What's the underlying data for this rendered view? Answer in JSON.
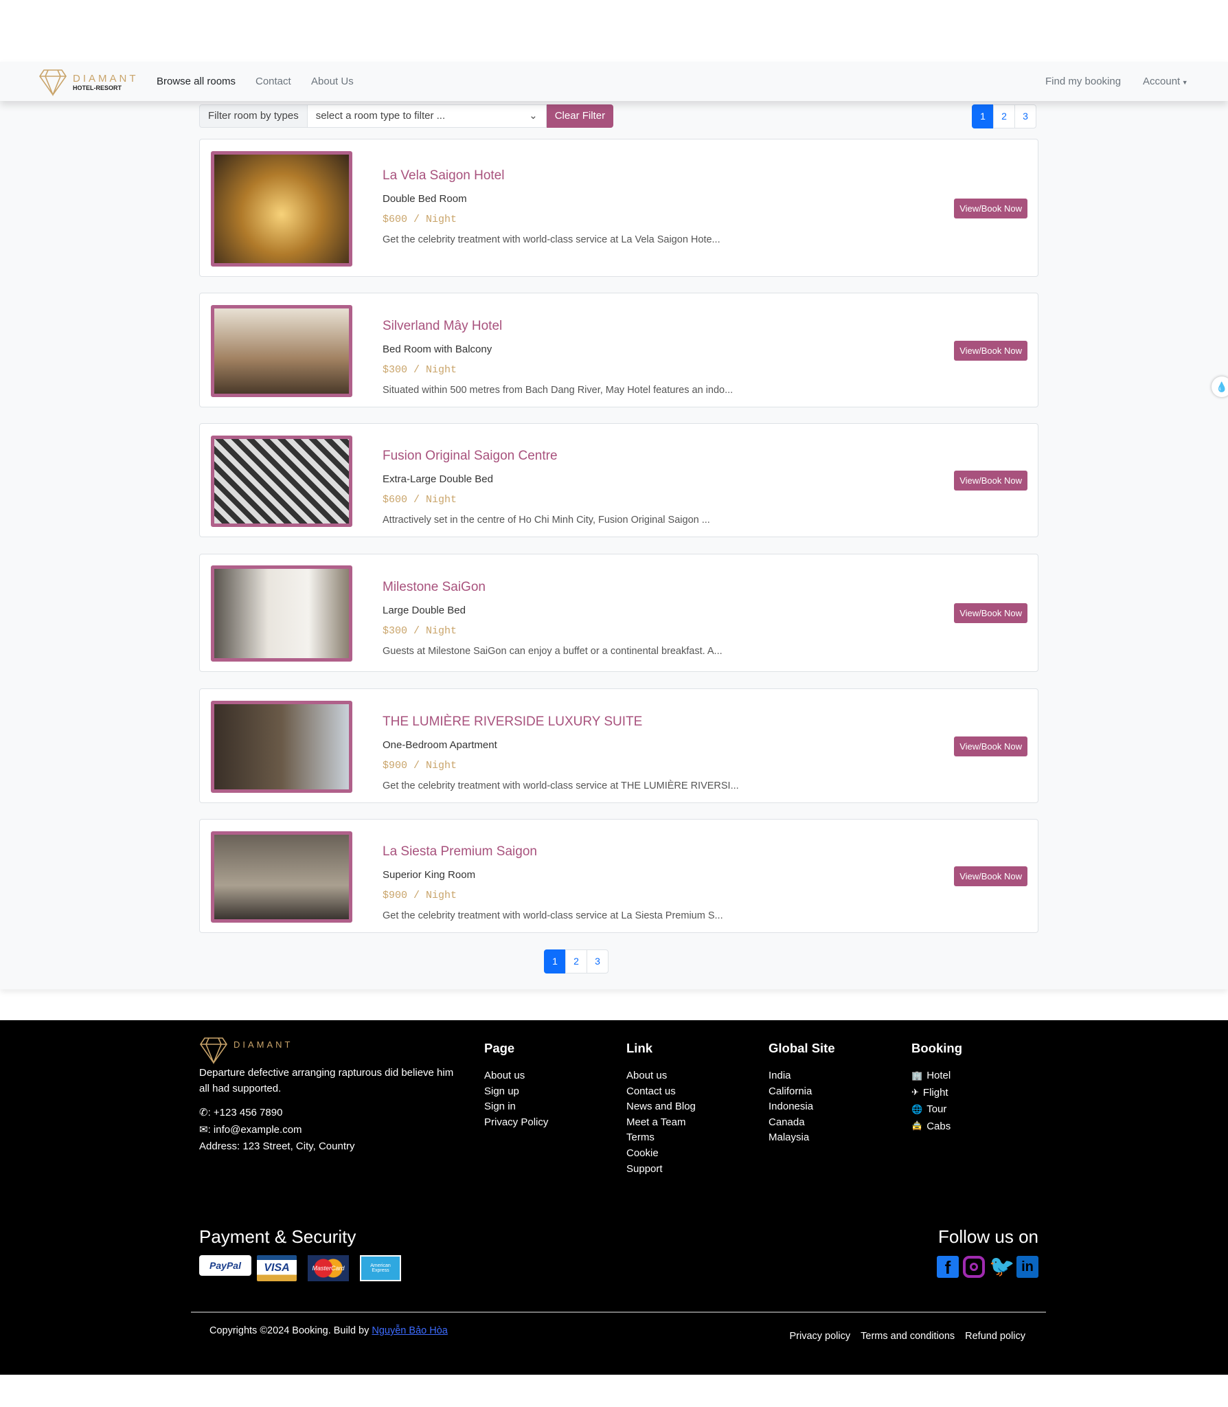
{
  "brand": {
    "name": "DIAMANT",
    "tagline": "HOTEL-RESORT",
    "gold": "#c9a46a",
    "accent": "#a8527d"
  },
  "nav": {
    "links": [
      "Browse all rooms",
      "Contact",
      "About Us"
    ],
    "right": [
      "Find my booking",
      "Account"
    ]
  },
  "filter": {
    "label": "Filter room by types",
    "placeholder": "select a room type to filter ...",
    "clear": "Clear Filter"
  },
  "pagination": {
    "pages": [
      "1",
      "2",
      "3"
    ],
    "current": "1"
  },
  "rooms": [
    {
      "name": "La Vela Saigon Hotel",
      "type": "Double Bed Room",
      "price": "$600 / Night",
      "desc": "Get the celebrity treatment with world-class service at La Vela Saigon Hote...",
      "button": "View/Book Now"
    },
    {
      "name": "Silverland Mây Hotel",
      "type": "Bed Room with Balcony",
      "price": "$300 / Night",
      "desc": "Situated within 500 metres from Bach Dang River, May Hotel features an indo...",
      "button": "View/Book Now"
    },
    {
      "name": "Fusion Original Saigon Centre",
      "type": "Extra-Large Double Bed",
      "price": "$600 / Night",
      "desc": "Attractively set in the centre of Ho Chi Minh City, Fusion Original Saigon ...",
      "button": "View/Book Now"
    },
    {
      "name": "Milestone SaiGon",
      "type": "Large Double Bed",
      "price": "$300 / Night",
      "desc": "Guests at Milestone SaiGon can enjoy a buffet or a continental breakfast. A...",
      "button": "View/Book Now"
    },
    {
      "name": "THE LUMIÈRE RIVERSIDE LUXURY SUITE",
      "type": "One-Bedroom Apartment",
      "price": "$900 / Night",
      "desc": "Get the celebrity treatment with world-class service at THE LUMIÈRE RIVERSI...",
      "button": "View/Book Now"
    },
    {
      "name": "La Siesta Premium Saigon",
      "type": "Superior King Room",
      "price": "$900 / Night",
      "desc": "Get the celebrity treatment with world-class service at La Siesta Premium S...",
      "button": "View/Book Now"
    }
  ],
  "footer": {
    "about": "Departure defective arranging rapturous did believe him all had supported.",
    "phone": ": +123 456 7890",
    "email": ": info@example.com",
    "address": "Address: 123 Street, City, Country",
    "cols": [
      {
        "title": "Page",
        "items": [
          "About us",
          "Sign up",
          "Sign in",
          "Privacy Policy"
        ]
      },
      {
        "title": "Link",
        "items": [
          "About us",
          "Contact us",
          "News and Blog",
          "Meet a Team",
          "Terms",
          "Cookie",
          "Support"
        ]
      },
      {
        "title": "Global Site",
        "items": [
          "India",
          "California",
          "Indonesia",
          "Canada",
          "Malaysia"
        ]
      },
      {
        "title": "Booking",
        "items": [
          "Hotel",
          "Flight",
          "Tour",
          "Cabs"
        ]
      }
    ],
    "payment_title": "Payment & Security",
    "payments": [
      "PayPal",
      "VISA",
      "MasterCard",
      "American Express"
    ],
    "follow_title": "Follow us on",
    "socials": [
      "facebook-icon",
      "instagram-icon",
      "twitter-icon",
      "linkedin-icon"
    ],
    "copyright": "Copyrights ©2024 Booking. Build by ",
    "author": "Nguyễn Bảo Hòa",
    "policies": [
      "Privacy policy",
      "Terms and conditions",
      "Refund policy"
    ]
  }
}
